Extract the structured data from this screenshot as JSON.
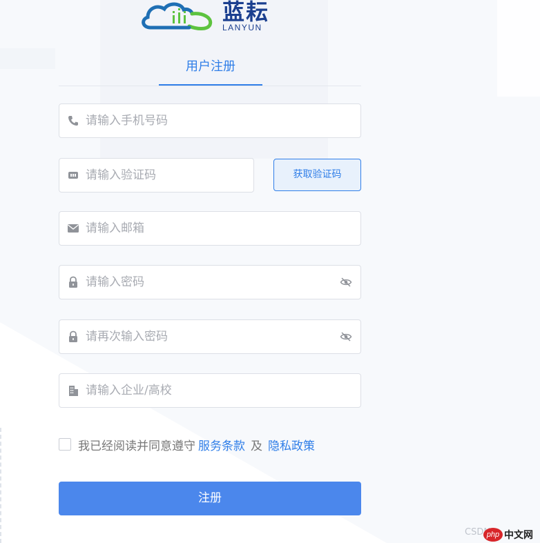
{
  "brand": {
    "name": "蓝耘",
    "subtitle": "LANYUN",
    "colors": {
      "primary": "#2f7ee8",
      "logo_blue": "#1b3f8f",
      "logo_green": "#5dc33f"
    }
  },
  "tabs": [
    {
      "label": "用户注册",
      "active": true
    }
  ],
  "form": {
    "phone": {
      "placeholder": "请输入手机号码",
      "icon": "phone-icon"
    },
    "code": {
      "placeholder": "请输入验证码",
      "icon": "sms-code-icon",
      "button_label": "获取验证码"
    },
    "email": {
      "placeholder": "请输入邮箱",
      "icon": "envelope-icon"
    },
    "password": {
      "placeholder": "请输入密码",
      "icon": "lock-icon"
    },
    "confirm_password": {
      "placeholder": "请再次输入密码",
      "icon": "lock-icon"
    },
    "organization": {
      "placeholder": "请输入企业/高校",
      "icon": "building-icon"
    }
  },
  "agreement": {
    "checked": false,
    "prefix": "我已经阅读并同意遵守",
    "terms_link": "服务条款",
    "conjunction": "及",
    "privacy_link": "隐私政策"
  },
  "submit_label": "注册",
  "watermark": {
    "text": "CSDN",
    "badge": "php",
    "site": "中文网"
  }
}
